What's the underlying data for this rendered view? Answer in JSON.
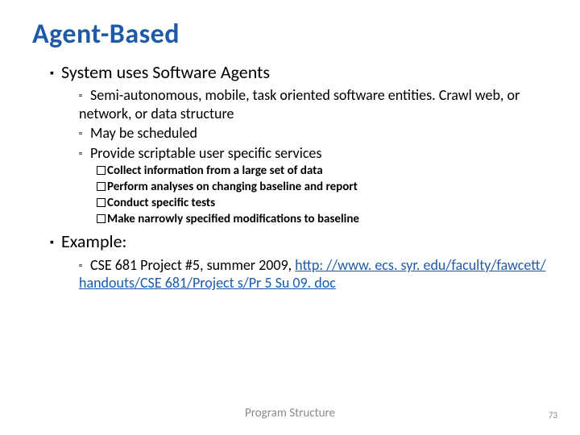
{
  "title": "Agent-Based",
  "l1_a": "System uses Software Agents",
  "l2_a1": "Semi-autonomous, mobile, task oriented software entities.  Crawl web, or network, or data structure",
  "l2_a2": "May be scheduled",
  "l2_a3": "Provide scriptable user specific services",
  "l3_a": "Collect information from a large set of data",
  "l3_b": "Perform analyses on changing baseline and report",
  "l3_c": "Conduct specific tests",
  "l3_d": "Make narrowly specified modifications to baseline",
  "l1_b": "Example:",
  "l2_b1_pre": "CSE 681 Project #5, summer 2009, ",
  "l2_b1_link": "http: //www. ecs. syr. edu/faculty/fawcett/handouts/CSE 681/Project s/Pr 5 Su 09. doc",
  "footer": "Program Structure",
  "page": "73"
}
